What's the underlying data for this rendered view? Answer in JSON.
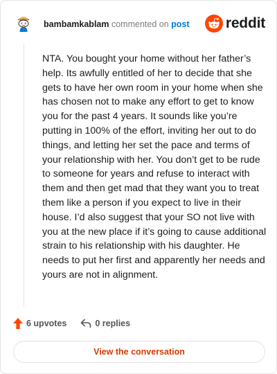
{
  "comment": {
    "username": "bambamkablam",
    "action_text": "commented on",
    "post_link_label": "post",
    "avatar_icon": "snoo-avatar-icon",
    "body": "NTA. You bought your home without her father’s help. Its awfully entitled of her to decide that she gets to have her own room in your home when she has chosen not to make any effort to get to know you for the past 4 years. It sounds like you’re putting in 100% of the effort, inviting her out to do things, and letting her set the pace and terms of your relationship with her. You don’t get to be rude to someone for years and refuse to interact with them and then get mad that they want you to treat them like a person if you expect to live in their house. I’d also suggest that your SO not live with you at the new place if it’s going to cause additional strain to his relationship with his daughter. He needs to put her first and apparently her needs and yours are not in alignment.",
    "upvotes_label": "6 upvotes",
    "replies_label": "0 replies",
    "view_button_label": "View the conversation"
  },
  "brand": {
    "wordmark": "reddit",
    "logo_icon": "reddit-logo-icon",
    "color": "#ff4500"
  },
  "colors": {
    "upvote": "#ff4500",
    "link": "#0079d3",
    "button_text": "#d93a00",
    "muted": "#7c7c7c"
  }
}
